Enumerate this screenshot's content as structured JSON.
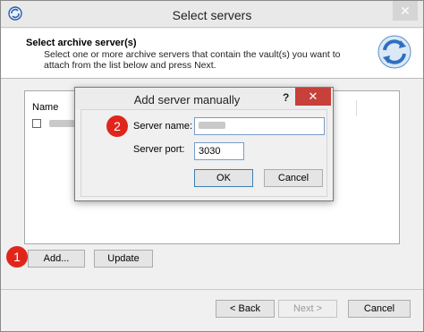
{
  "window": {
    "title": "Select servers",
    "close_glyph": "✕",
    "app_icon": "refresh-app-icon"
  },
  "header": {
    "title": "Select archive server(s)",
    "description": "Select one or more archive servers that contain the vault(s) you want to attach from the list below and press Next.",
    "logo_icon": "sync-arrows-icon"
  },
  "list": {
    "column_name": "Name",
    "rows": [
      {
        "checked": false,
        "name_redacted": true
      }
    ]
  },
  "buttons": {
    "add": "Add...",
    "update": "Update",
    "back": "< Back",
    "next": "Next >",
    "cancel": "Cancel"
  },
  "badges": {
    "one": "1",
    "two": "2"
  },
  "dialog": {
    "title": "Add server manually",
    "help_glyph": "?",
    "close_glyph": "✕",
    "server_name_label": "Server name:",
    "server_name_value_redacted": true,
    "server_port_label": "Server port:",
    "server_port_value": "3030",
    "ok": "OK",
    "cancel": "Cancel"
  },
  "colors": {
    "badge_red": "#e0261b",
    "close_red": "#c7403a",
    "input_border": "#7a9cc8"
  }
}
